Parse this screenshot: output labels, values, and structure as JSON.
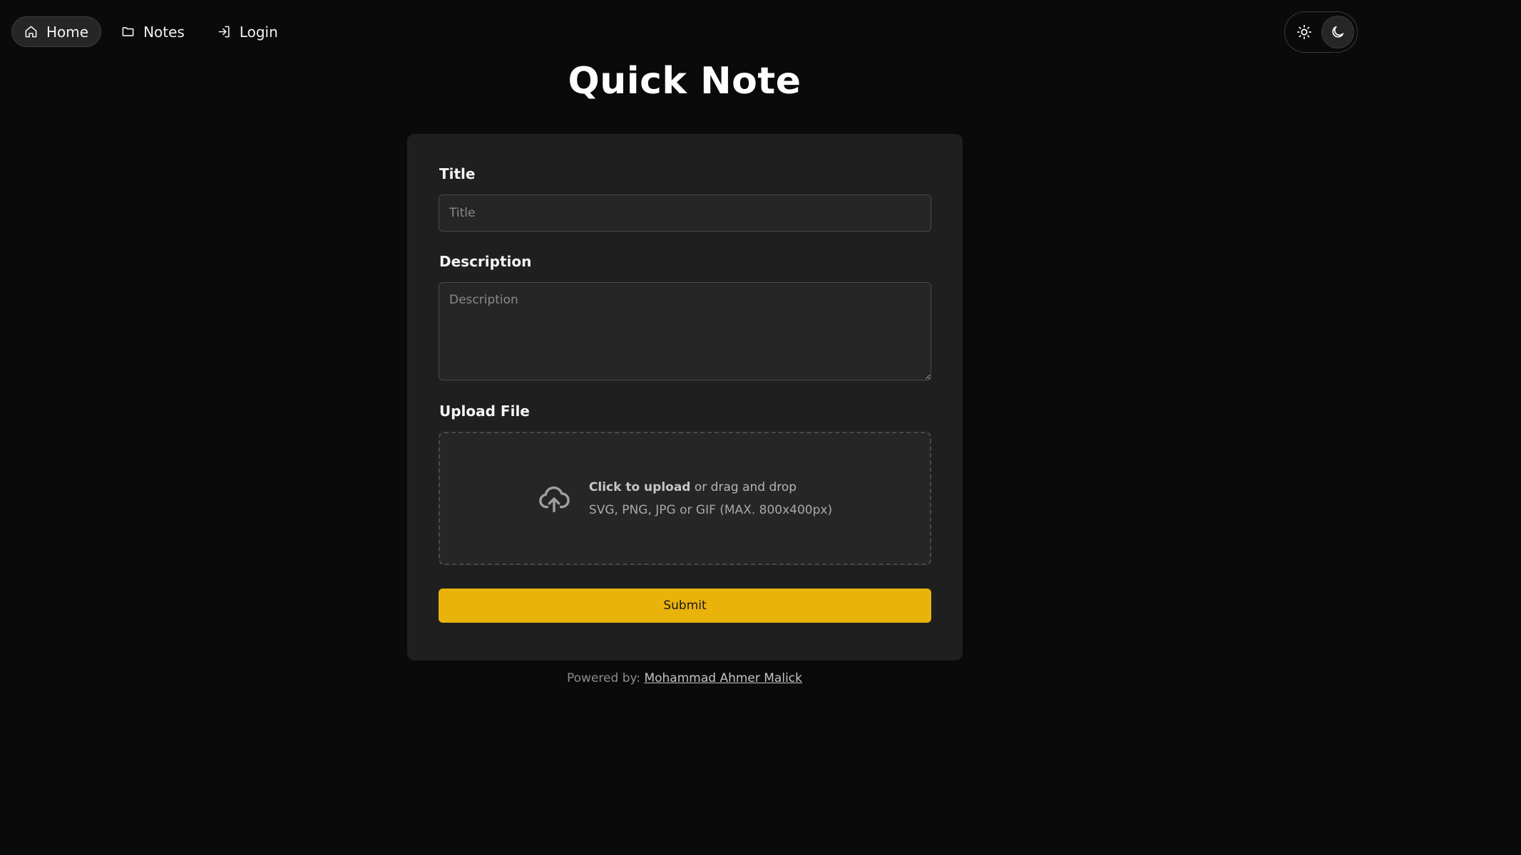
{
  "nav": {
    "items": [
      {
        "label": "Home",
        "icon": "home-icon",
        "active": true
      },
      {
        "label": "Notes",
        "icon": "folder-icon",
        "active": false
      },
      {
        "label": "Login",
        "icon": "login-icon",
        "active": false
      }
    ]
  },
  "theme": {
    "options": [
      "sun-icon",
      "moon-icon"
    ],
    "selected": "dark"
  },
  "page": {
    "title": "Quick Note"
  },
  "form": {
    "title_label": "Title",
    "title_value": "",
    "title_placeholder": "Title",
    "description_label": "Description",
    "description_value": "",
    "description_placeholder": "Description",
    "upload_label": "Upload File",
    "upload_cta": "Click to upload",
    "upload_rest": "or drag and drop",
    "upload_hint": "SVG, PNG, JPG or GIF (MAX. 800x400px)",
    "submit_label": "Submit"
  },
  "footer": {
    "prefix": "Powered by:",
    "author": "Mohammad Ahmer Malick"
  },
  "colors": {
    "background": "#0a0a0a",
    "card": "#1f1f1f",
    "accent": "#eab30c"
  }
}
